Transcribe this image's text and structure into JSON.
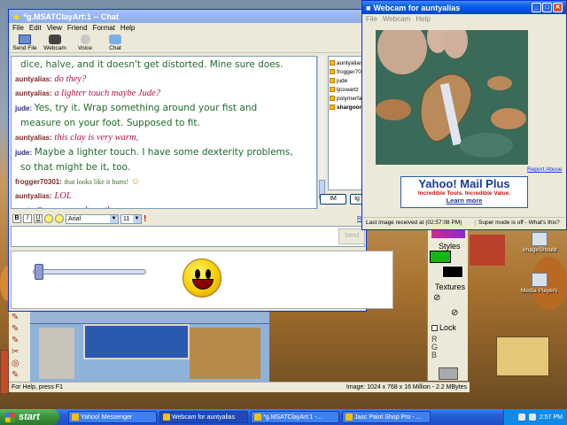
{
  "chat_window": {
    "title": "*g.MSATClayArt:1  -- Chat",
    "menu": [
      "File",
      "Edit",
      "View",
      "Friend",
      "Format",
      "Help"
    ],
    "toolbar": [
      "Send File",
      "Webcam",
      "Voice",
      "Chat"
    ],
    "messages": [
      {
        "who": "",
        "text": "dice, halve, and it doesn't get distorted. Mine sure does.",
        "style": "green"
      },
      {
        "who": "auntyalias:",
        "text": "do they?",
        "style": "red"
      },
      {
        "who": "auntyalias:",
        "text": "a lighter touch maybe Jude?",
        "style": "red"
      },
      {
        "who": "jude:",
        "text": "Yes, try it. Wrap something around your fist and",
        "style": "green"
      },
      {
        "who": "",
        "text": "measure on your foot. Supposed to fit.",
        "style": "green"
      },
      {
        "who": "auntyalias:",
        "text": "this clay is very warm,",
        "style": "red"
      },
      {
        "who": "jude:",
        "text": "Maybe a lighter touch. I have some dexterity problems,",
        "style": "green"
      },
      {
        "who": "",
        "text": "so that might be it, too.",
        "style": "green"
      },
      {
        "who": "frogger70301:",
        "text": "that looks like it hurts!",
        "style": "small"
      },
      {
        "who": "auntyalias:",
        "text": "LOL",
        "style": "red"
      },
      {
        "who": "auntyalias:",
        "text": "now we bury the pen",
        "style": "red"
      }
    ],
    "users": [
      "auntyalias",
      "frogger7030",
      "jude",
      "ljcswartz",
      "polymerfair",
      "shargoon"
    ],
    "im_button": "IM",
    "ig_button": "Ig",
    "font": "Arial",
    "size": "11",
    "format_buttons": [
      "B",
      "I",
      "U"
    ],
    "partial_link": "Re",
    "send_label": "Send"
  },
  "webcam_window": {
    "title": "Webcam for auntyalias",
    "menu": [
      "File",
      "Webcam",
      "Help"
    ],
    "report_abuse": "Report Abuse",
    "ad": {
      "title": "Yahoo! Mail Plus",
      "subtitle": "Incredible Tools. Incredible Value.",
      "link": "Learn more"
    },
    "status_left": "Last image received at (02:57:08 PM)",
    "status_right": "Super mode is off - What's this?"
  },
  "psp": {
    "styles_label": "Styles",
    "textures_label": "Textures",
    "lock_label": "Lock",
    "rgb": [
      "R",
      "G",
      "B"
    ],
    "image_info": "Image:  1024 x 768 x 16 Million - 2.2 MBytes",
    "help_status": "For Help, press F1"
  },
  "desktop_icons": [
    "ImageShould",
    "Media Players"
  ],
  "taskbar": {
    "start": "start",
    "tasks": [
      "Yahoo! Messenger",
      "Webcam for auntyalias",
      "*g.MSATClayArt:1 -...",
      "Jasc Paint Shop Pro - ..."
    ],
    "clock": "2:57 PM"
  },
  "colors": {
    "titlebar": "#0a5fe0",
    "green_text": "#1e6a2a",
    "red_text": "#b0103a"
  }
}
